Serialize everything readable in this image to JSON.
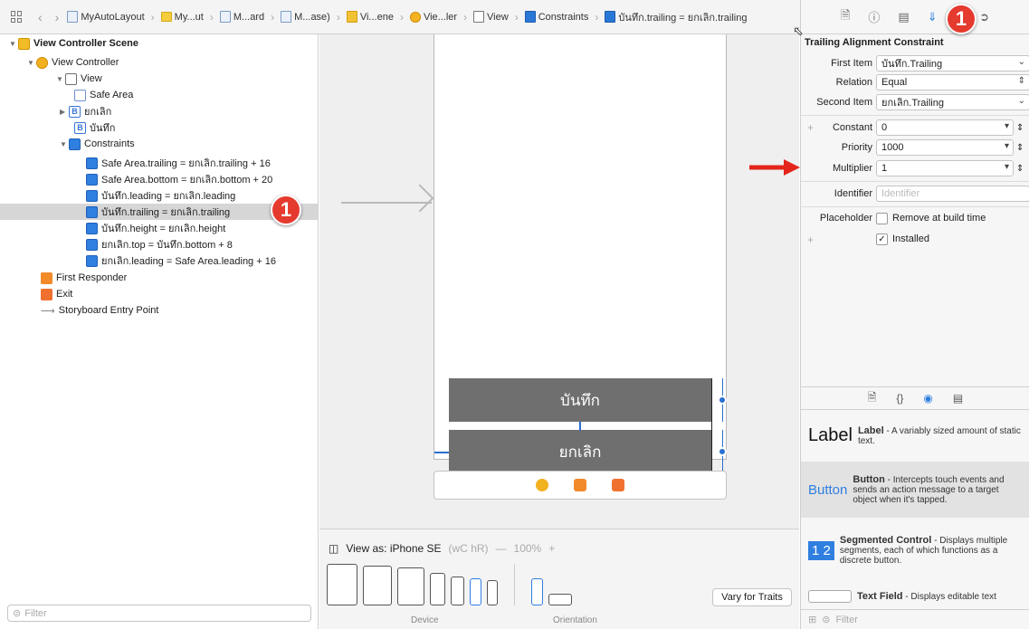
{
  "breadcrumbs": [
    "MyAutoLayout",
    "My...ut",
    "M...ard",
    "M...ase)",
    "Vi...ene",
    "Vie...ler",
    "View",
    "Constraints",
    "บันทึก.trailing = ยกเลิก.trailing"
  ],
  "outline": {
    "items": [
      {
        "label": "View Controller Scene",
        "icon": "storyboard-scene-icon"
      },
      {
        "label": "View Controller",
        "icon": "view-controller-icon"
      },
      {
        "label": "View",
        "icon": "view-icon"
      },
      {
        "label": "Safe Area",
        "icon": "safe-area-icon"
      },
      {
        "label": "ยกเลิก",
        "icon": "button-icon"
      },
      {
        "label": "บันทึก",
        "icon": "button-icon"
      },
      {
        "label": "Constraints",
        "icon": "constraints-icon"
      },
      {
        "label": "Safe Area.trailing = ยกเลิก.trailing + 16",
        "icon": "constraint-icon"
      },
      {
        "label": "Safe Area.bottom = ยกเลิก.bottom + 20",
        "icon": "constraint-icon"
      },
      {
        "label": "บันทึก.leading = ยกเลิก.leading",
        "icon": "constraint-icon"
      },
      {
        "label": "บันทึก.trailing = ยกเลิก.trailing",
        "icon": "constraint-icon",
        "selected": true
      },
      {
        "label": "บันทึก.height = ยกเลิก.height",
        "icon": "constraint-icon"
      },
      {
        "label": "ยกเลิก.top = บันทึก.bottom + 8",
        "icon": "constraint-icon"
      },
      {
        "label": "ยกเลิก.leading = Safe Area.leading + 16",
        "icon": "constraint-icon"
      },
      {
        "label": "First Responder",
        "icon": "first-responder-icon"
      },
      {
        "label": "Exit",
        "icon": "exit-icon"
      },
      {
        "label": "Storyboard Entry Point",
        "icon": "entry-arrow-icon"
      }
    ],
    "filter_placeholder": "Filter"
  },
  "badge_number": "1",
  "canvas": {
    "button_save": "บันทึก",
    "button_cancel": "ยกเลิก"
  },
  "bottombar": {
    "view_as": "View as: iPhone SE",
    "traits": "(wC hR)",
    "zoom": "100%",
    "device_label": "Device",
    "orientation_label": "Orientation",
    "vary_button": "Vary for Traits"
  },
  "inspector": {
    "section_title": "Trailing Alignment Constraint",
    "first_item_label": "First Item",
    "first_item_value": "บันทึก.Trailing",
    "relation_label": "Relation",
    "relation_value": "Equal",
    "second_item_label": "Second Item",
    "second_item_value": "ยกเลิก.Trailing",
    "constant_label": "Constant",
    "constant_value": "0",
    "priority_label": "Priority",
    "priority_value": "1000",
    "multiplier_label": "Multiplier",
    "multiplier_value": "1",
    "identifier_label": "Identifier",
    "identifier_placeholder": "Identifier",
    "placeholder_label": "Placeholder",
    "placeholder_check_label": "Remove at build time",
    "installed_label": "Installed",
    "installed": true
  },
  "library": {
    "items": [
      {
        "preview": "Label",
        "title": "Label",
        "desc": " - A variably sized amount of static text."
      },
      {
        "preview": "Button",
        "title": "Button",
        "desc": " - Intercepts touch events and sends an action message to a target object when it's tapped."
      },
      {
        "preview": "1 2",
        "title": "Segmented Control",
        "desc": " - Displays multiple segments, each of which functions as a discrete button."
      },
      {
        "preview": "",
        "title": "Text Field",
        "desc": " - Displays editable text"
      }
    ],
    "filter_placeholder": "Filter"
  },
  "colors": {
    "accent": "#2f7fe0",
    "badge": "#e53a2e",
    "button_gray": "#6f6f6f",
    "constraint_blue": "#2a6fd1"
  }
}
